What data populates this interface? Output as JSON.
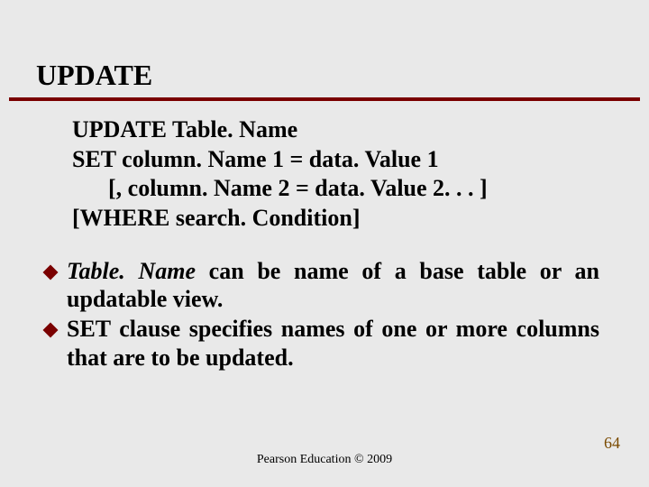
{
  "title": "UPDATE",
  "syntax": {
    "line1": "UPDATE Table. Name",
    "line2": "SET column. Name 1 = data. Value 1",
    "line3": "[, column. Name 2 = data. Value 2. . . ]",
    "line4": "[WHERE search. Condition]"
  },
  "bullets": [
    {
      "emph": "Table. Name",
      "rest": " can be name of a base table or an updatable view."
    },
    {
      "emph": "",
      "rest": "SET clause specifies names of one or more columns that are to be updated."
    }
  ],
  "footer": "Pearson Education © 2009",
  "pagenum": "64"
}
